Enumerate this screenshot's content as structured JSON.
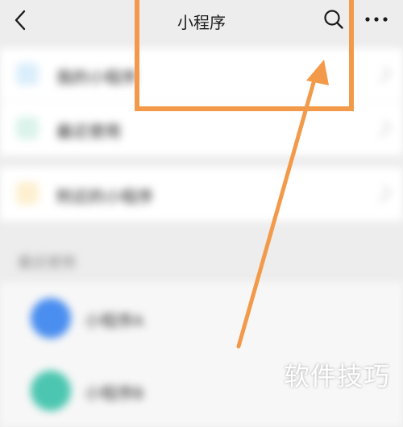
{
  "header": {
    "title": "小程序",
    "back_icon": "back-chevron-icon",
    "search_icon": "search-icon",
    "more_icon": "more-dots-icon"
  },
  "menu": {
    "items": [
      {
        "label": "我的小程序",
        "icon_color": "#dbeefb"
      },
      {
        "label": "最近使用",
        "icon_color": "#dbf3ea"
      },
      {
        "label": "附近的小程序",
        "icon_color": "#fdf0d0"
      }
    ]
  },
  "recent": {
    "section_label": "最近使用",
    "apps": [
      {
        "name": "小程序A",
        "color": "#4a8ef0"
      },
      {
        "name": "小程序B",
        "color": "#4cc6b0"
      }
    ]
  },
  "annotation": {
    "color": "#f39a4a",
    "watermark": "软件技巧"
  }
}
